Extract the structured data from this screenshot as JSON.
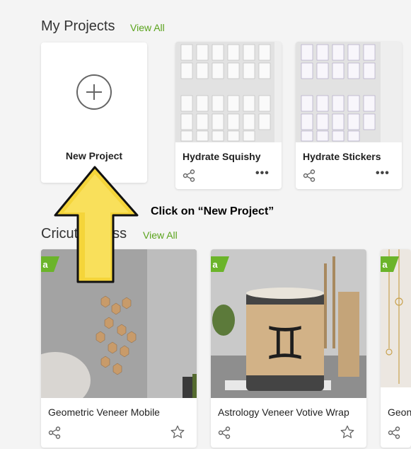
{
  "my_projects": {
    "title": "My Projects",
    "view_all": "View All",
    "new_project_label": "New Project",
    "projects": [
      {
        "name": "Hydrate Squishy"
      },
      {
        "name": "Hydrate Stickers"
      }
    ]
  },
  "cricut_access": {
    "title": "Cricut Access",
    "view_all": "View All",
    "items": [
      {
        "name": "Geometric Veneer Mobile"
      },
      {
        "name": "Astrology Veneer Votive Wrap"
      },
      {
        "name": "Geon"
      }
    ]
  },
  "annotation": {
    "callout": "Click on “New Project”"
  },
  "colors": {
    "accent_green": "#5aa31c",
    "arrow_yellow": "#f5d53a"
  },
  "icons": {
    "plus": "plus-circle-icon",
    "share": "share-icon",
    "more": "more-options-icon",
    "star": "star-icon",
    "access_badge": "cricut-access-badge"
  }
}
